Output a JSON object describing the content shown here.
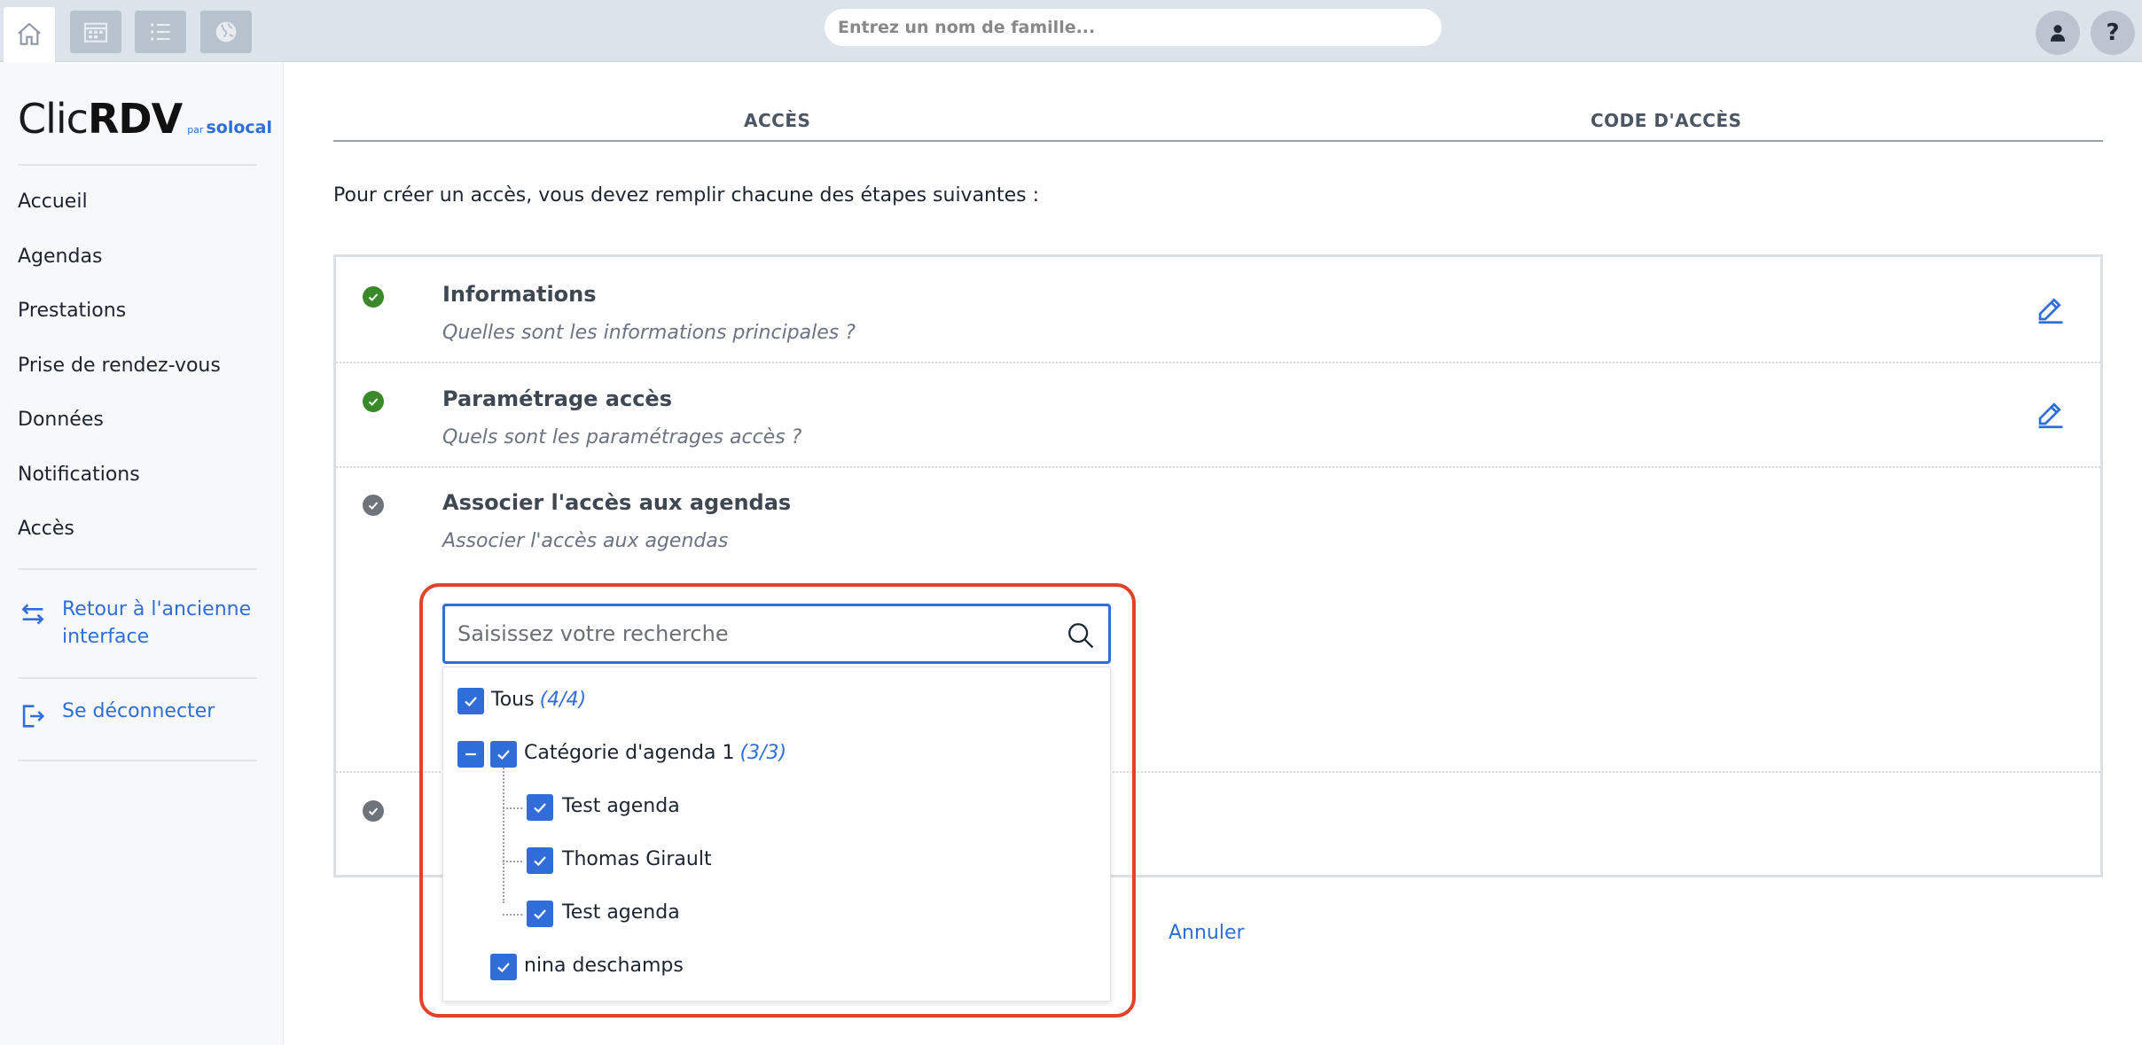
{
  "topbar": {
    "search_placeholder": "Entrez un nom de famille...",
    "help_label": "?"
  },
  "sidebar": {
    "logo": {
      "clic": "Clic",
      "rdv": "RDV",
      "par": "par",
      "solocal": "solocal"
    },
    "nav": [
      "Accueil",
      "Agendas",
      "Prestations",
      "Prise de rendez-vous",
      "Données",
      "Notifications",
      "Accès"
    ],
    "back_link": "Retour à l'ancienne interface",
    "logout": "Se déconnecter"
  },
  "tabs": [
    "ACCÈS",
    "CODE D'ACCÈS"
  ],
  "intro": "Pour créer un accès, vous devez remplir chacune des étapes suivantes :",
  "steps": [
    {
      "title": "Informations",
      "subtitle": "Quelles sont les informations principales ?",
      "status": "complete"
    },
    {
      "title": "Paramétrage accès",
      "subtitle": "Quels sont les paramétrages accès ?",
      "status": "complete"
    },
    {
      "title": "Associer l'accès aux agendas",
      "subtitle": "Associer l'accès aux agendas",
      "status": "current"
    }
  ],
  "agenda_picker": {
    "search_placeholder": "Saisissez votre recherche",
    "items": [
      {
        "label": "Tous",
        "count": "(4/4)",
        "checked": true
      },
      {
        "label": "Catégorie d'agenda 1",
        "count": "(3/3)",
        "checked": true
      },
      {
        "label": "Test agenda",
        "checked": true
      },
      {
        "label": "Thomas Girault",
        "checked": true
      },
      {
        "label": "Test agenda",
        "checked": true
      },
      {
        "label": "nina deschamps",
        "checked": true
      }
    ]
  },
  "cancel_label": "Annuler",
  "colors": {
    "accent": "#2f6ed8",
    "success": "#3a8a2a",
    "highlight": "#e2412a"
  }
}
